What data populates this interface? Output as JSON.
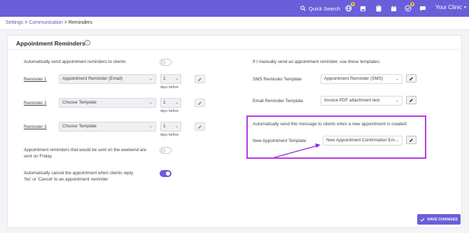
{
  "topbar": {
    "quick_search": "Quick Search",
    "clinic": "Your Clinic",
    "badge_1": "1",
    "badge_2": "3"
  },
  "breadcrumb": {
    "settings": "Settings",
    "sep1": " > ",
    "communication": "Communication",
    "sep2": " > ",
    "current": "Reminders"
  },
  "card": {
    "title": "Appointment Reminders",
    "info": "i"
  },
  "left": {
    "auto_send_label": "Automatically send appointment reminders to clients",
    "auto_send_on": false,
    "reminders": [
      {
        "label": "Reminder 1",
        "template": "Appointment Reminder (Email)",
        "days": "1",
        "days_label": "days before"
      },
      {
        "label": "Reminder 2",
        "template": "Choose Template",
        "days": "1",
        "days_label": "days before"
      },
      {
        "label": "Reminder 3",
        "template": "Choose Template",
        "days": "1",
        "days_label": "days before"
      }
    ],
    "weekend_label_1": "Appointment reminders that would be sent on the weekend are",
    "weekend_label_2": "sent on Friday",
    "weekend_on": false,
    "cancel_label_1": "Automatically cancel the appointment when clients reply",
    "cancel_label_2": "'No' or 'Cancel' to an appointment reminder",
    "cancel_on": true
  },
  "right": {
    "manual_heading": "If I manually send an appointment reminder, use these templates:",
    "sms_label": "SMS Reminder Template",
    "sms_value": "Appointment Reminder (SMS)",
    "email_label": "Email Reminder Template",
    "email_value": "Invoice PDF attachment test",
    "auto_new_heading": "Automatically send this message to clients when a new appointment is created:",
    "new_label": "New Appointment Template",
    "new_value": "New Appointment Confirmation Em"
  },
  "footer": {
    "save_label": "SAVE CHANGES"
  },
  "colors": {
    "brand": "#6a5fd8",
    "highlight": "#b83be0",
    "link": "#5b57c9"
  }
}
